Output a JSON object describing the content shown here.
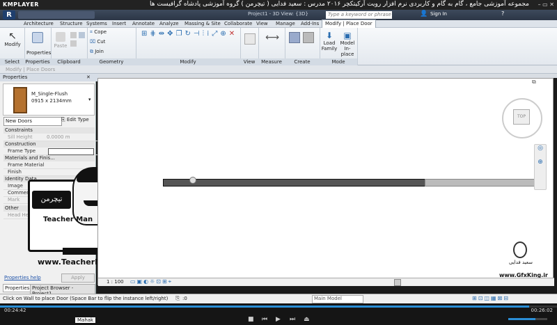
{
  "player": {
    "logo": "KMPLAYER",
    "video_title": "مجموعه آموزشی جامع ، گام به گام و کاربردی نرم افزار رویت آرکیتکچر ۲۰۱۶    مدرس : سعید فدایی ( تیچرمن ) گروه آموزشی پادشاه گرافیست ها",
    "time_elapsed": "00:24:42",
    "time_total": "00:26:02",
    "tooltip": "Mahak",
    "window_buttons": "– ▭ ✕"
  },
  "revit": {
    "title_center": "Project1 - 3D View: {3D}",
    "search_placeholder": "Type a keyword or phrase",
    "signin": "Sign In",
    "tabs": [
      "Architecture",
      "Structure",
      "Systems",
      "Insert",
      "Annotate",
      "Analyze",
      "Massing & Site",
      "Collaborate",
      "View",
      "Manage",
      "Add-Ins",
      "Modify | Place Door"
    ],
    "active_tab": "Modify | Place Door",
    "panels": [
      "Select",
      "Properties",
      "Clipboard",
      "Geometry",
      "Modify",
      "View",
      "Measure",
      "Create",
      "Mode"
    ],
    "buttons": {
      "modify": "Modify",
      "properties": "Properties",
      "paste": "Paste",
      "cope": "Cope",
      "cut": "Cut",
      "join": "Join",
      "load_family": "Load\nFamily",
      "model_inplace": "Model\nIn-place"
    },
    "context_bar": "Modify | Place Doors",
    "properties_panel": {
      "header": "Properties",
      "family": "M_Single-Flush",
      "type": "0915 x 2134mm",
      "selector": "New Doors",
      "edit_type": "Edit Type",
      "sections": [
        {
          "name": "Constraints",
          "rows": [
            {
              "label": "Sill Height",
              "value": "0.0000 m",
              "dim": true
            }
          ]
        },
        {
          "name": "Construction",
          "rows": [
            {
              "label": "Frame Type",
              "value": "",
              "dim": false
            }
          ]
        },
        {
          "name": "Materials and Finis...",
          "rows": [
            {
              "label": "Frame Material",
              "value": "",
              "dim": false
            },
            {
              "label": "Finish",
              "value": "",
              "dim": false
            }
          ]
        },
        {
          "name": "Identity Data",
          "rows": [
            {
              "label": "Image",
              "value": "",
              "dim": false
            },
            {
              "label": "Comments",
              "value": "",
              "dim": false
            },
            {
              "label": "Mark",
              "value": "",
              "dim": true
            }
          ]
        },
        {
          "name": "Other",
          "rows": [
            {
              "label": "Head Height",
              "value": "",
              "dim": true
            }
          ]
        }
      ],
      "help_link": "Properties help",
      "apply": "Apply",
      "bottom_tabs": [
        "Properties",
        "Project Browser - Project1"
      ]
    },
    "watermark_left": {
      "brand": "تیچرمن",
      "subtitle": "Teacher Man",
      "url": "www.TeacherMan.ir"
    },
    "watermark_right": {
      "name": "سعید فدایی",
      "url": "www.GfxKing.ir"
    },
    "view_scale": "1 : 100",
    "status_text": "Click on Wall to place Door (Space Bar to flip the instance left/right)",
    "status_zero": ":0",
    "main_model": "Main Model"
  }
}
